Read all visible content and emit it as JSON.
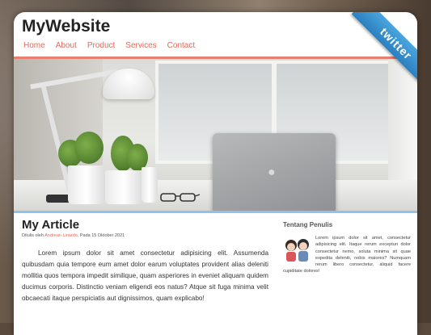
{
  "site": {
    "title": "MyWebsite"
  },
  "nav": [
    "Home",
    "About",
    "Product",
    "Services",
    "Contact"
  ],
  "ribbon": {
    "label": "twitter"
  },
  "article": {
    "title": "My Article",
    "meta_prefix": "Ditulis oleh",
    "author": "Andrean Linardo",
    "meta_suffix": ", Pada 15 Oktober 2021",
    "body": "Lorem ipsum dolor sit amet consectetur adipisicing elit. Assumenda quibusdam quia tempore eum amet dolor earum voluptates provident alias deleniti mollitia quos tempora impedit similique, quam asperiores in eveniet aliquam quidem ducimus corporis. Distinctio veniam eligendi eos natus? Atque sit fuga minima velit obcaecati itaque perspiciatis aut dignissimos, quam explicabo!"
  },
  "sidebar": {
    "title": "Tentang Penulis",
    "text": "Lorem ipsum dolor sit amet, consectetur adipisicing elit. Itaque rerum excepturi dolor consectetur nemo, soluta minima sit quae expedita deleniti, nobis maiores? Numquam rerum libero consectetur, aliquid facere cupiditate dolores!"
  },
  "colors": {
    "accent": "#e06a5c",
    "ribbon": "#2b7fbf",
    "divider": "#8ec2ea"
  }
}
